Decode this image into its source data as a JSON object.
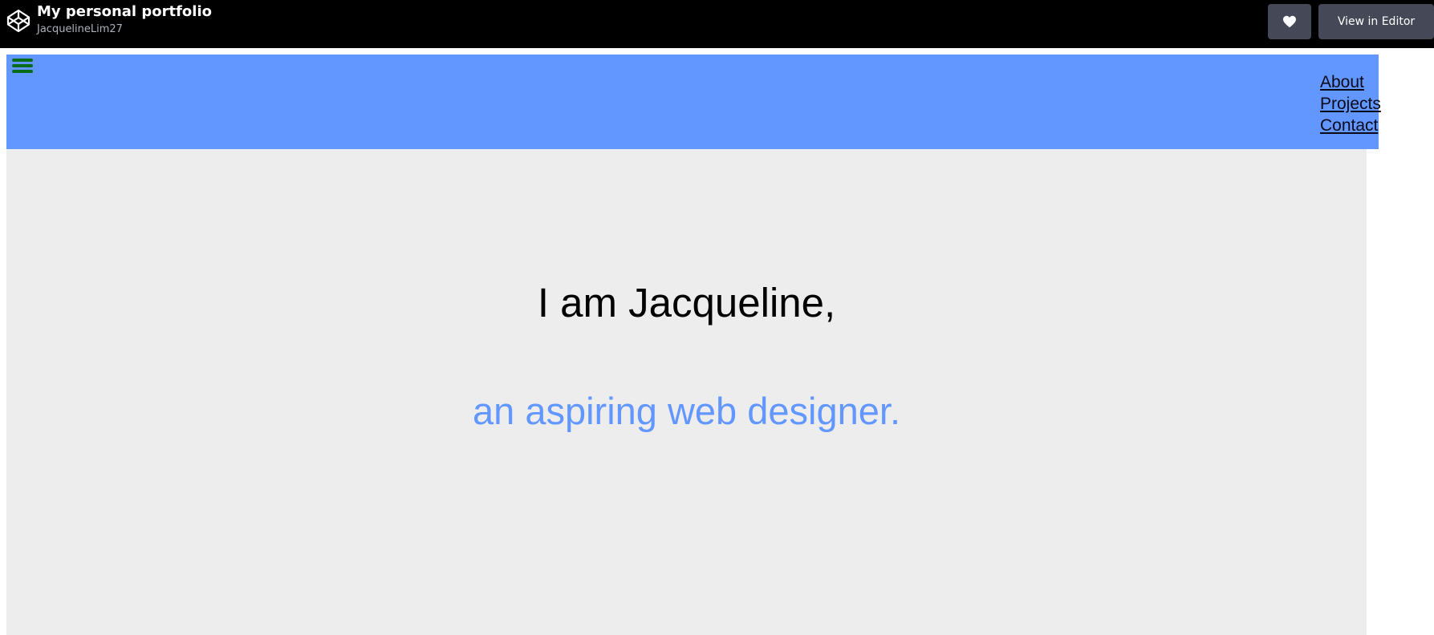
{
  "topbar": {
    "title": "My personal portfolio",
    "author": "JacquelineLim27",
    "heart_icon": "heart-icon",
    "view_editor_label": "View in Editor",
    "logo_icon": "codepen-logo-icon"
  },
  "site": {
    "header_color": "#6297ff",
    "menu_icon": "hamburger-icon",
    "nav": [
      {
        "label": "About"
      },
      {
        "label": "Projects"
      },
      {
        "label": "Contact"
      }
    ]
  },
  "hero": {
    "heading": "I am Jacqueline,",
    "tagline": "an aspiring web designer.",
    "tagline_color": "#6297ff",
    "background": "#ededed"
  }
}
